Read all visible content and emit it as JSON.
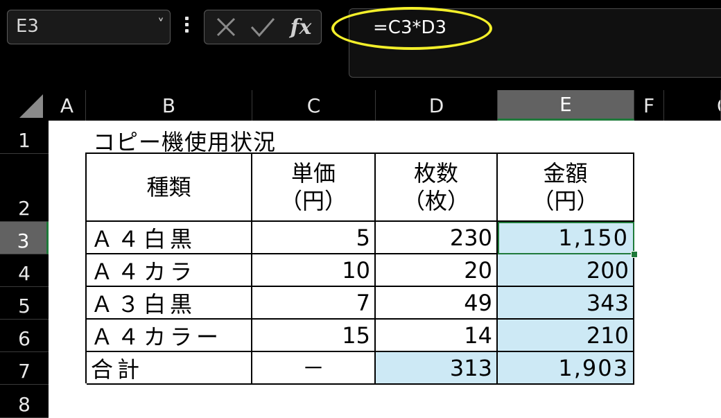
{
  "toolbar": {
    "name_box": "E3",
    "name_box_caret": "˅",
    "fx_label": "fx",
    "formula": "=C3*D3"
  },
  "columns": [
    "A",
    "B",
    "C",
    "D",
    "E",
    "F",
    "G"
  ],
  "rows": [
    "1",
    "2",
    "3",
    "4",
    "5",
    "6",
    "7",
    "8"
  ],
  "selected_cell": "E3",
  "sheet": {
    "title": "コピー機使用状況",
    "headers": {
      "type": "種類",
      "unit_price_line1": "単価",
      "unit_price_line2": "（円）",
      "count_line1": "枚数",
      "count_line2": "（枚）",
      "amount_line1": "金額",
      "amount_line2": "（円）"
    },
    "rows": [
      {
        "type": "Ａ４白黒",
        "price": "5",
        "count": "230",
        "amount": "1,150"
      },
      {
        "type": "Ａ４カラ",
        "price": "10",
        "count": "20",
        "amount": "200"
      },
      {
        "type": "Ａ３白黒",
        "price": "7",
        "count": "49",
        "amount": "343"
      },
      {
        "type": "Ａ４カラー",
        "price": "15",
        "count": "14",
        "amount": "210"
      }
    ],
    "total": {
      "label": "合計",
      "price": "－",
      "count": "313",
      "amount": "1,903"
    }
  },
  "colors": {
    "highlight_ellipse": "#f3ef2a",
    "calc_cell_fill": "#cde9f5",
    "selection": "#1f7a3a"
  }
}
